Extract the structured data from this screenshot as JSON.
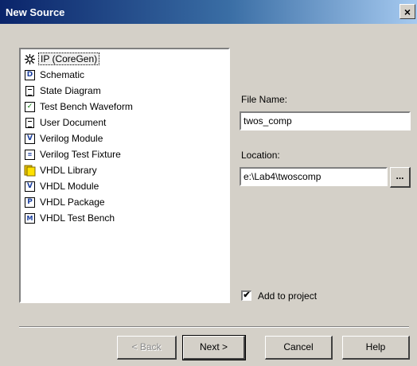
{
  "window": {
    "title": "New Source",
    "close_label": "×"
  },
  "source_types": [
    {
      "label": "IP (CoreGen)",
      "icon": "coregen-icon"
    },
    {
      "label": "Schematic",
      "icon": "schematic-icon"
    },
    {
      "label": "State Diagram",
      "icon": "state-diagram-icon"
    },
    {
      "label": "Test Bench Waveform",
      "icon": "waveform-icon"
    },
    {
      "label": "User Document",
      "icon": "document-icon"
    },
    {
      "label": "Verilog Module",
      "icon": "verilog-module-icon"
    },
    {
      "label": "Verilog Test Fixture",
      "icon": "verilog-fixture-icon"
    },
    {
      "label": "VHDL Library",
      "icon": "folder-icon"
    },
    {
      "label": "VHDL Module",
      "icon": "vhdl-module-icon"
    },
    {
      "label": "VHDL Package",
      "icon": "vhdl-package-icon"
    },
    {
      "label": "VHDL Test Bench",
      "icon": "vhdl-testbench-icon"
    }
  ],
  "file_name": {
    "label": "File Name:",
    "value": "twos_comp"
  },
  "location": {
    "label": "Location:",
    "value": "e:\\Lab4\\twoscomp",
    "browse_label": "..."
  },
  "add_to_project": {
    "label": "Add to project",
    "checked": true,
    "mark": "✔"
  },
  "buttons": {
    "back": "< Back",
    "next": "Next >",
    "cancel": "Cancel",
    "help": "Help"
  }
}
